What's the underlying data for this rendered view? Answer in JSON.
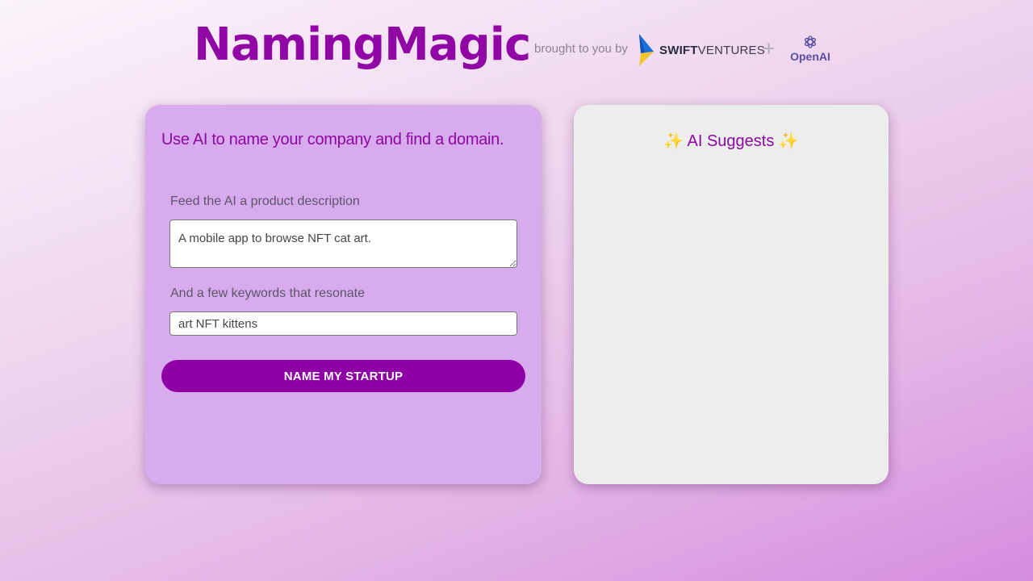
{
  "header": {
    "title": "NamingMagic",
    "brought_by": "brought to you by",
    "swift_bold": "SWIFT",
    "swift_rest": "VENTURES",
    "plus": "+",
    "openai": "OpenAI"
  },
  "form": {
    "lead": "Use AI to name your company and find a domain.",
    "description_label": "Feed the AI a product description",
    "description_value": "A mobile app to browse NFT cat art.",
    "keywords_label": "And a few keywords that resonate",
    "keywords_value": "art NFT kittens",
    "submit_label": "NAME MY STARTUP"
  },
  "results": {
    "sparkle": "✨",
    "title": "AI Suggests"
  },
  "colors": {
    "brand_purple": "#8e00a6",
    "form_card": "#d8abee",
    "results_card": "#eeedee"
  },
  "icons": [
    "swift-ventures-logo-icon",
    "openai-logo-icon",
    "sparkle-icon"
  ]
}
